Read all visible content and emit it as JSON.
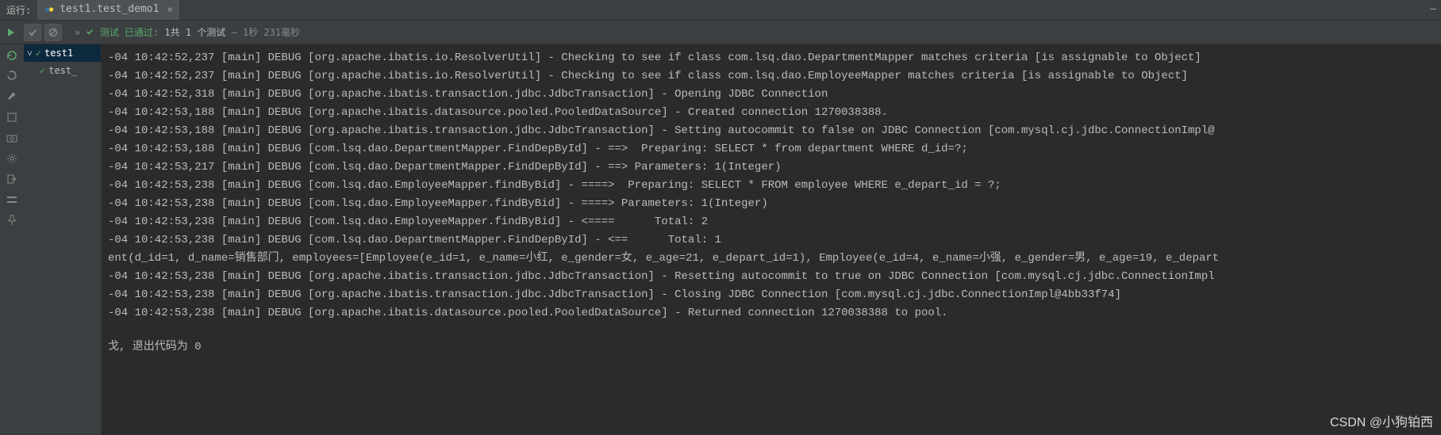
{
  "header": {
    "run_label": "运行:",
    "tab_title": "test1.test_demo1",
    "close_glyph": "×"
  },
  "toolbar": {
    "status_prefix": "»",
    "status_pass": "测试 已通过:",
    "status_count": "1共 1 个测试",
    "status_time": "– 1秒 231毫秒"
  },
  "tree": {
    "root": "test1",
    "child": "test_"
  },
  "console_lines": [
    "-04 10:42:52,237 [main] DEBUG [org.apache.ibatis.io.ResolverUtil] - Checking to see if class com.lsq.dao.DepartmentMapper matches criteria [is assignable to Object]",
    "-04 10:42:52,237 [main] DEBUG [org.apache.ibatis.io.ResolverUtil] - Checking to see if class com.lsq.dao.EmployeeMapper matches criteria [is assignable to Object]",
    "-04 10:42:52,318 [main] DEBUG [org.apache.ibatis.transaction.jdbc.JdbcTransaction] - Opening JDBC Connection",
    "-04 10:42:53,188 [main] DEBUG [org.apache.ibatis.datasource.pooled.PooledDataSource] - Created connection 1270038388.",
    "-04 10:42:53,188 [main] DEBUG [org.apache.ibatis.transaction.jdbc.JdbcTransaction] - Setting autocommit to false on JDBC Connection [com.mysql.cj.jdbc.ConnectionImpl@",
    "-04 10:42:53,188 [main] DEBUG [com.lsq.dao.DepartmentMapper.FindDepById] - ==>  Preparing: SELECT * from department WHERE d_id=?;",
    "-04 10:42:53,217 [main] DEBUG [com.lsq.dao.DepartmentMapper.FindDepById] - ==> Parameters: 1(Integer)",
    "-04 10:42:53,238 [main] DEBUG [com.lsq.dao.EmployeeMapper.findByBid] - ====>  Preparing: SELECT * FROM employee WHERE e_depart_id = ?;",
    "-04 10:42:53,238 [main] DEBUG [com.lsq.dao.EmployeeMapper.findByBid] - ====> Parameters: 1(Integer)",
    "-04 10:42:53,238 [main] DEBUG [com.lsq.dao.EmployeeMapper.findByBid] - <====      Total: 2",
    "-04 10:42:53,238 [main] DEBUG [com.lsq.dao.DepartmentMapper.FindDepById] - <==      Total: 1",
    "ent(d_id=1, d_name=销售部门, employees=[Employee(e_id=1, e_name=小红, e_gender=女, e_age=21, e_depart_id=1), Employee(e_id=4, e_name=小强, e_gender=男, e_age=19, e_depart",
    "-04 10:42:53,238 [main] DEBUG [org.apache.ibatis.transaction.jdbc.JdbcTransaction] - Resetting autocommit to true on JDBC Connection [com.mysql.cj.jdbc.ConnectionImpl",
    "-04 10:42:53,238 [main] DEBUG [org.apache.ibatis.transaction.jdbc.JdbcTransaction] - Closing JDBC Connection [com.mysql.cj.jdbc.ConnectionImpl@4bb33f74]",
    "-04 10:42:53,238 [main] DEBUG [org.apache.ibatis.datasource.pooled.PooledDataSource] - Returned connection 1270038388 to pool."
  ],
  "exit_line": "戈, 退出代码为 0",
  "watermark": "CSDN @小狗铂西"
}
